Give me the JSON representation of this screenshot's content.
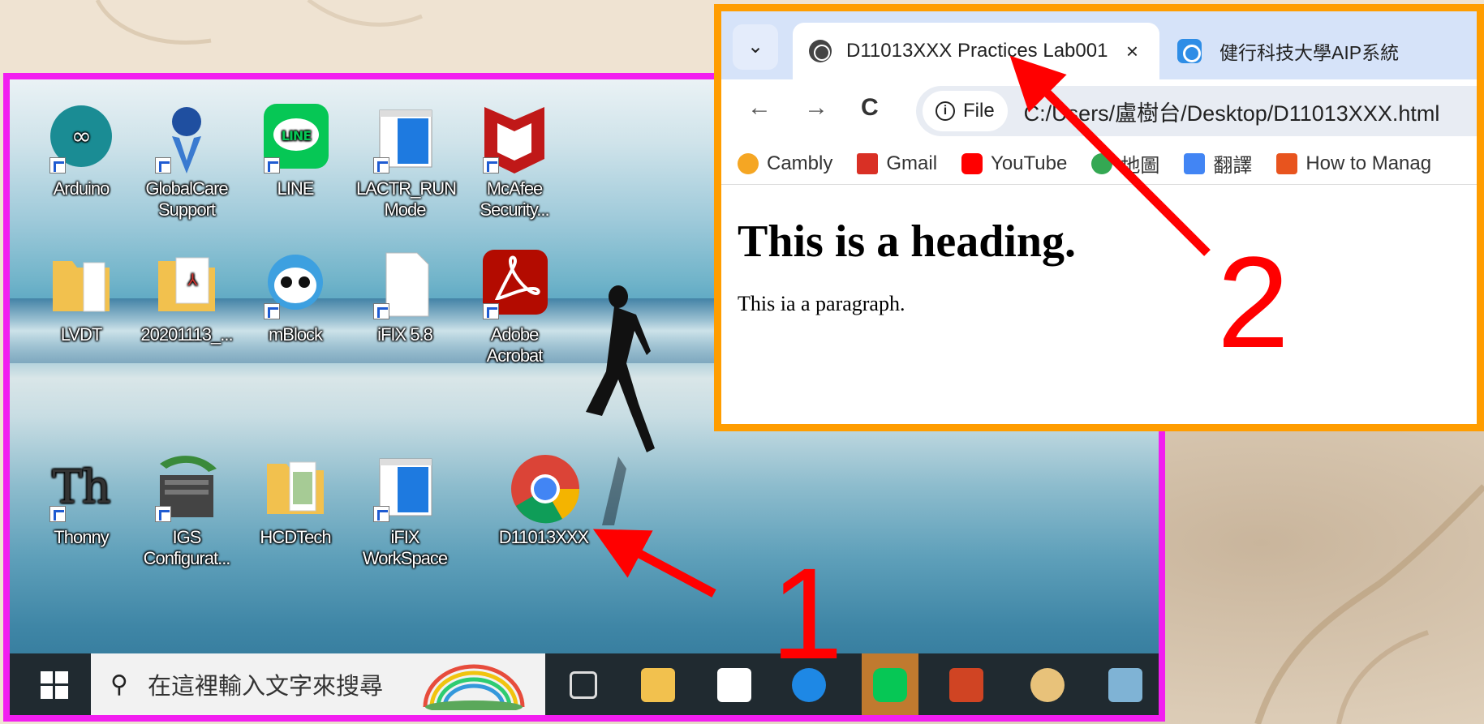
{
  "desktop": {
    "icons": [
      {
        "label": "Arduino",
        "icon": "arduino-icon"
      },
      {
        "label": "GlobalCare\nSupport",
        "icon": "globalcare-icon"
      },
      {
        "label": "LINE",
        "icon": "line-icon"
      },
      {
        "label": "LACTR_RUN\nMode",
        "icon": "window-app-icon"
      },
      {
        "label": "McAfee\nSecurity...",
        "icon": "mcafee-icon"
      },
      {
        "label": "LVDT",
        "icon": "folder-icon"
      },
      {
        "label": "20201113_...",
        "icon": "pdf-icon"
      },
      {
        "label": "mBlock",
        "icon": "mblock-icon"
      },
      {
        "label": "iFIX 5.8",
        "icon": "file-icon"
      },
      {
        "label": "Adobe\nAcrobat",
        "icon": "acrobat-icon"
      },
      {
        "label": "Thonny",
        "icon": "thonny-icon"
      },
      {
        "label": "IGS\nConfigurat...",
        "icon": "igs-icon"
      },
      {
        "label": "HCDTech",
        "icon": "folder-icon"
      },
      {
        "label": "iFIX\nWorkSpace",
        "icon": "window-app-icon"
      },
      {
        "label": "D11013XXX",
        "icon": "chrome-icon"
      }
    ]
  },
  "taskbar": {
    "search_placeholder": "在這裡輸入文字來搜尋",
    "items": [
      "task-view-icon",
      "file-explorer-icon",
      "store-icon",
      "edge-icon",
      "line-icon",
      "powerpoint-icon",
      "paint-icon",
      "notepad-icon"
    ]
  },
  "browser": {
    "tab_active": "D11013XXX Practices Lab001",
    "tab_close": "×",
    "tab_second": "健行科技大學AIP系統",
    "tab_menu": "⌄",
    "nav": {
      "back": "←",
      "forward": "→",
      "reload": "C"
    },
    "file_chip": "File",
    "url": "C:/Users/盧樹台/Desktop/D11013XXX.html",
    "bookmarks": [
      {
        "label": "Cambly",
        "color": "#f5a623"
      },
      {
        "label": "Gmail",
        "color": "#d93025"
      },
      {
        "label": "YouTube",
        "color": "#ff0000"
      },
      {
        "label": "地圖",
        "color": "#34a853"
      },
      {
        "label": "翻譯",
        "color": "#4285f4"
      },
      {
        "label": "How to Manag",
        "color": "#e8541e"
      }
    ],
    "heading": "This is a heading.",
    "paragraph": "This ia a paragraph."
  },
  "annotations": {
    "step1": "1",
    "step2": "2",
    "arrow_color": "#ff0000"
  }
}
